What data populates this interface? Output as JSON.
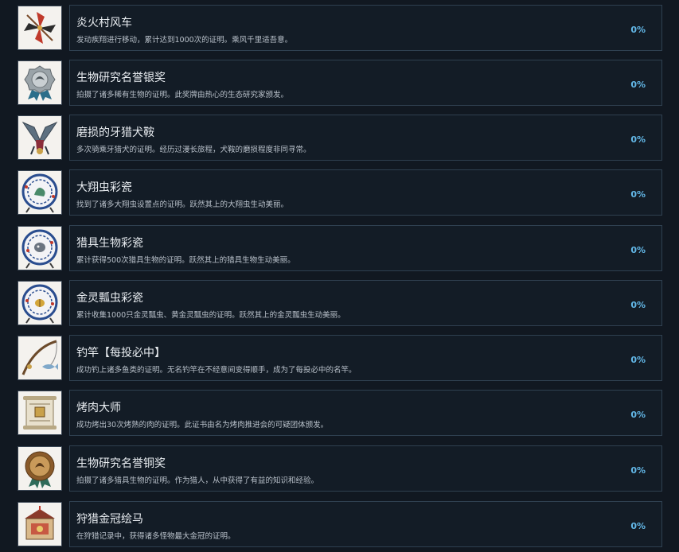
{
  "achievements": [
    {
      "title": "炎火村风车",
      "description": "发动疾翔进行移动，累计达到1000次的证明。乘风千里适吾意。",
      "percent": "0%",
      "icon": "pinwheel-icon"
    },
    {
      "title": "生物研究名誉银奖",
      "description": "拍摄了诸多稀有生物的证明。此奖牌由热心的生态研究家颁发。",
      "percent": "0%",
      "icon": "silver-medal-icon"
    },
    {
      "title": "磨损的牙猎犬鞍",
      "description": "多次骑乘牙猎犬的证明。经历过漫长旅程，犬鞍的磨损程度非同寻常。",
      "percent": "0%",
      "icon": "saddle-icon"
    },
    {
      "title": "大翔虫彩瓷",
      "description": "找到了诸多大翔虫设置点的证明。跃然其上的大翔虫生动美丽。",
      "percent": "0%",
      "icon": "porcelain-plate-icon"
    },
    {
      "title": "猎具生物彩瓷",
      "description": "累计获得500次猎具生物的证明。跃然其上的猎具生物生动美丽。",
      "percent": "0%",
      "icon": "porcelain-plate-icon"
    },
    {
      "title": "金灵瓢虫彩瓷",
      "description": "累计收集1000只金灵瓢虫、黄金灵瓢虫的证明。跃然其上的金灵瓢虫生动美丽。",
      "percent": "0%",
      "icon": "porcelain-plate-icon"
    },
    {
      "title": "钓竿【每投必中】",
      "description": "成功钓上诸多鱼类的证明。无名钓竿在不经意间变得顺手，成为了每投必中的名竿。",
      "percent": "0%",
      "icon": "fishing-rod-icon"
    },
    {
      "title": "烤肉大师",
      "description": "成功烤出30次烤熟的肉的证明。此证书由名为烤肉推进会的可疑团体颁发。",
      "percent": "0%",
      "icon": "certificate-scroll-icon"
    },
    {
      "title": "生物研究名誉铜奖",
      "description": "拍摄了诸多猎具生物的证明。作为猎人，从中获得了有益的知识和经验。",
      "percent": "0%",
      "icon": "bronze-medal-icon"
    },
    {
      "title": "狩猎金冠绘马",
      "description": "在狩猎记录中，获得诸多怪物最大金冠的证明。",
      "percent": "0%",
      "icon": "ema-plaque-icon"
    }
  ]
}
